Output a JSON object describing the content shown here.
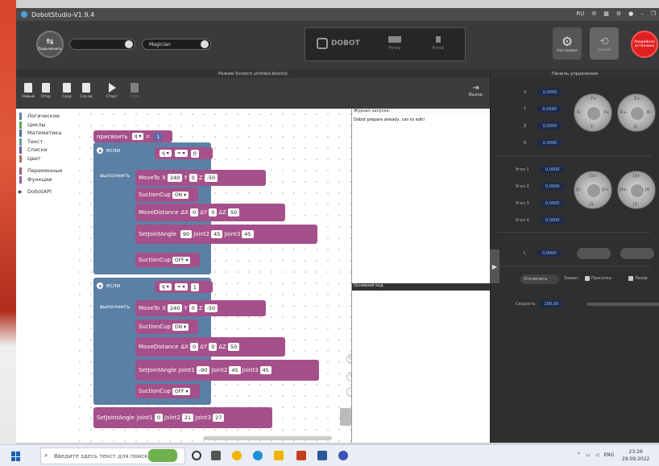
{
  "window": {
    "title": "DobotStudio-V1.9.4",
    "title_icons": [
      "ru",
      "mail-icon",
      "tile-icon",
      "gear-icon",
      "color-icon",
      "minimize-icon",
      "maximize-icon"
    ]
  },
  "toolbar": {
    "connect_label": "Подключить",
    "port_value": "",
    "device_value": "Magician",
    "brand": "DOBOT",
    "end_tool_label": "Ручка",
    "mode_label": "Ручка",
    "settings_label": "Настройки",
    "home_label": "Домой",
    "estop_label": "Аварийная остановка"
  },
  "editor": {
    "header": "Режим Scratch  untitled.blockly",
    "tools": [
      "Новый",
      "Откр",
      "Сохр",
      "Сох-ак",
      "Старт",
      "Стоп"
    ],
    "exit_label": "Выход"
  },
  "palette": {
    "categories": [
      {
        "label": "Логические",
        "color": "#5b80a5"
      },
      {
        "label": "Циклы",
        "color": "#5ba55b"
      },
      {
        "label": "Математика",
        "color": "#5b67a5"
      },
      {
        "label": "Текст",
        "color": "#5ba58c"
      },
      {
        "label": "Списки",
        "color": "#745ba5"
      },
      {
        "label": "Цвет",
        "color": "#a5745b"
      },
      {
        "label": "Переменные",
        "color": "#a55b80"
      },
      {
        "label": "Функции",
        "color": "#995ba5"
      },
      {
        "label": "DobotAPI",
        "color": "#333333"
      }
    ]
  },
  "blocks": {
    "assign": {
      "label": "присвоить",
      "var": "q",
      "eq": "=",
      "value": "1"
    },
    "if1": {
      "if_label": "если",
      "do_label": "выполнить",
      "cond": {
        "var": "q",
        "op": "=",
        "value": "0"
      },
      "moveto": {
        "label": "MoveTo",
        "x_label": "X",
        "x": "240",
        "y_label": "Y",
        "y": "0",
        "z_label": "Z",
        "z": "-50"
      },
      "suction1": {
        "label": "SuctionCup",
        "state": "ON"
      },
      "movedist": {
        "label": "MoveDistance",
        "dx_label": "ΔX",
        "dx": "0",
        "dy_label": "ΔY",
        "dy": "0",
        "dz_label": "ΔZ",
        "dz": "50"
      },
      "joint": {
        "label": "SetJointAngle",
        "j1_label": "Joint1",
        "j1": "90",
        "j2_label": "Joint2",
        "j2": "45",
        "j3_label": "Joint3",
        "j3": "45"
      },
      "suction2": {
        "label": "SuctionCup",
        "state": "OFF"
      }
    },
    "if2": {
      "if_label": "если",
      "do_label": "выполнить",
      "cond": {
        "var": "q",
        "op": "=",
        "value": "1"
      },
      "moveto": {
        "label": "MoveTo",
        "x_label": "X",
        "x": "240",
        "y_label": "Y",
        "y": "0",
        "z_label": "Z",
        "z": "-50"
      },
      "suction1": {
        "label": "SuctionCup",
        "state": "ON"
      },
      "movedist": {
        "label": "MoveDistance",
        "dx_label": "ΔX",
        "dx": "0",
        "dy_label": "ΔY",
        "dy": "0",
        "dz_label": "ΔZ",
        "dz": "50"
      },
      "joint": {
        "label": "SetJointAngle",
        "j1_label": "Joint1",
        "j1": "-90",
        "j2_label": "Joint2",
        "j2": "45",
        "j3_label": "Joint3",
        "j3": "45"
      },
      "suction2": {
        "label": "SuctionCup",
        "state": "OFF"
      }
    },
    "final_joint": {
      "label": "SetJointAngle",
      "j1_label": "Joint1",
      "j1": "0",
      "j2_label": "Joint2",
      "j2": "21",
      "j3_label": "Joint3",
      "j3": "27"
    }
  },
  "log": {
    "title": "Журнал запуска:",
    "message": "Dobot prepare already, can to edit!"
  },
  "code": {
    "title": "Основной код"
  },
  "control": {
    "header": "Панель управления",
    "coords": [
      {
        "label": "X",
        "value": "0,0000"
      },
      {
        "label": "Y",
        "value": "0,0000"
      },
      {
        "label": "Z",
        "value": "0,0000"
      },
      {
        "label": "R",
        "value": "0,0000"
      }
    ],
    "joints": [
      {
        "label": "Угол 1",
        "value": "0,0000"
      },
      {
        "label": "Угол 2",
        "value": "0,0000"
      },
      {
        "label": "Угол 3",
        "value": "0,0000"
      },
      {
        "label": "Угол 4",
        "value": "0,0000"
      }
    ],
    "l": {
      "label": "L",
      "value": "0,0000"
    },
    "joy_labels": {
      "a": [
        "Y+",
        "X-",
        "X+",
        "Y-"
      ],
      "b": [
        "Z+",
        "R+",
        "R-",
        "Z-"
      ],
      "c": [
        "J1+",
        "J2-",
        "J2+",
        "J1-"
      ],
      "d": [
        "J3+",
        "J4+",
        "J4-",
        "J3-"
      ]
    },
    "disconnect_label": "Отключить",
    "checks": [
      "Захват",
      "Присоска",
      "Лазер"
    ],
    "speed_label": "Скорость",
    "speed_value": "100,00"
  },
  "taskbar": {
    "search_placeholder": "Введите здесь текст для поиска",
    "lang": "ENG",
    "time": "23:26",
    "date": "29.09.2022"
  }
}
